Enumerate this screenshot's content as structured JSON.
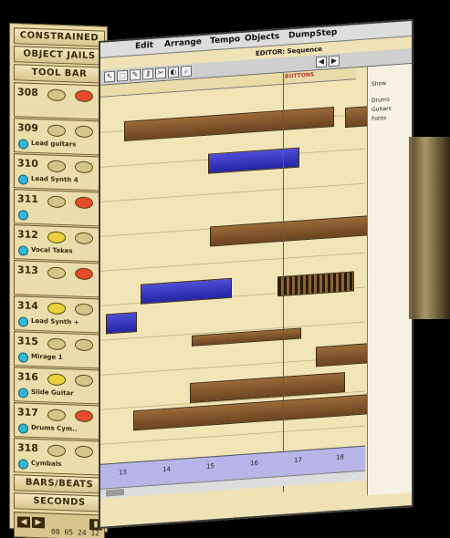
{
  "strip": {
    "buttons": [
      "CONSTRAINED",
      "OBJECT JAILS",
      "TOOL BAR"
    ],
    "tracks": [
      {
        "num": "308",
        "name": "",
        "knob1": "plain",
        "knob2": "red",
        "led": false
      },
      {
        "num": "309",
        "name": "Lead guitars",
        "knob1": "plain",
        "knob2": "plain",
        "led": true
      },
      {
        "num": "310",
        "name": "Lead Synth 4",
        "knob1": "plain",
        "knob2": "plain",
        "led": true
      },
      {
        "num": "311",
        "name": "",
        "knob1": "plain",
        "knob2": "red",
        "led": true
      },
      {
        "num": "312",
        "name": "Vocal Takes",
        "knob1": "yellow",
        "knob2": "plain",
        "led": true
      },
      {
        "num": "313",
        "name": "",
        "knob1": "plain",
        "knob2": "red",
        "led": false
      },
      {
        "num": "314",
        "name": "Lead Synth +",
        "knob1": "yellow",
        "knob2": "plain",
        "led": true
      },
      {
        "num": "315",
        "name": "Mirage 1",
        "knob1": "plain",
        "knob2": "plain",
        "led": true
      },
      {
        "num": "316",
        "name": "Slide Guitar",
        "knob1": "yellow",
        "knob2": "plain",
        "led": true
      },
      {
        "num": "317",
        "name": "Drums Cym..",
        "knob1": "plain",
        "knob2": "red",
        "led": true
      },
      {
        "num": "318",
        "name": "Cymbals",
        "knob1": "plain",
        "knob2": "plain",
        "led": true
      }
    ],
    "bars_beats": "BARS/BEATS",
    "seconds": "SECONDS",
    "time": "00 05 24 12"
  },
  "window": {
    "menus": [
      "Edit",
      "Arrange",
      "Tempo",
      "Objects",
      "Dump",
      "Step"
    ],
    "title": "EDITOR: Sequence",
    "playhead_label": "BUTTONS",
    "side_items": [
      "Show",
      "Drums",
      "Guitars",
      "Fonts"
    ],
    "ruler_labels": [
      "13",
      "14",
      "15",
      "16",
      "17",
      "18"
    ]
  },
  "colors": {
    "strip_bg": "#e7d8a6",
    "region_brown": "#8a5a2e",
    "region_blue": "#3436c2",
    "arrange_bg": "#f1e5b8",
    "led": "#2fb8d8"
  }
}
